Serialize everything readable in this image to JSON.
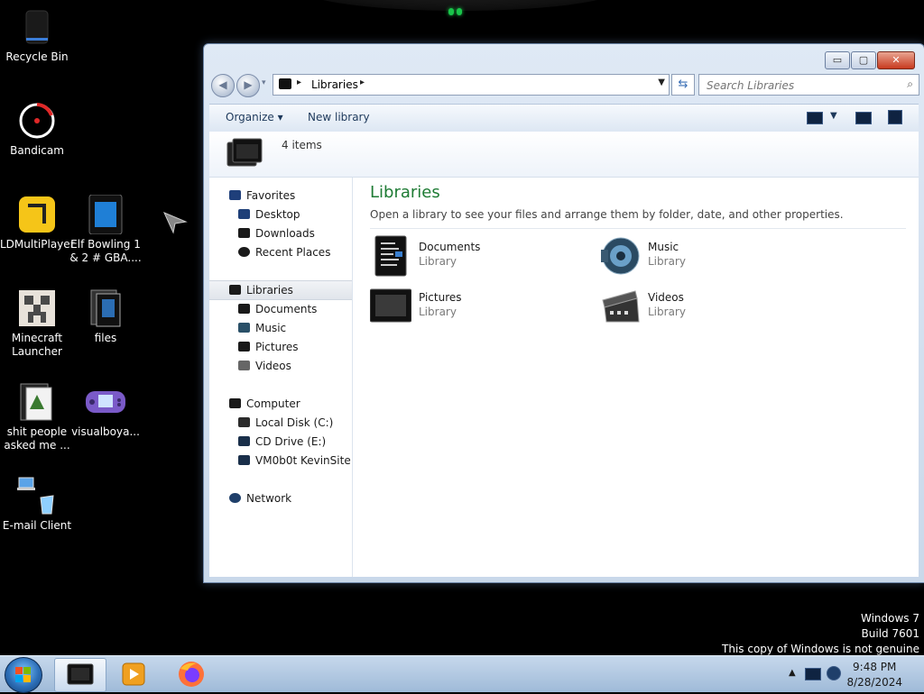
{
  "desktop": {
    "icons": [
      {
        "label": "Recycle Bin"
      },
      {
        "label": "Bandicam"
      },
      {
        "label": "LDMultiPlayer"
      },
      {
        "label": "Elf Bowling 1 & 2 # GBA...."
      },
      {
        "label": "Minecraft Launcher"
      },
      {
        "label": "files"
      },
      {
        "label": "shit people asked me ..."
      },
      {
        "label": "visualboya..."
      },
      {
        "label": "E-mail Client"
      }
    ]
  },
  "window": {
    "controls": {
      "minimize": "▭",
      "maximize": "▢",
      "close": "✕"
    },
    "address": {
      "path": "Libraries",
      "separator": "▸"
    },
    "search": {
      "placeholder": "Search Libraries"
    },
    "toolbar": {
      "organize": "Organize ▾",
      "new_library": "New library"
    },
    "info": {
      "count": "4 items"
    },
    "nav": {
      "favorites": "Favorites",
      "desktop": "Desktop",
      "downloads": "Downloads",
      "recent": "Recent Places",
      "libraries": "Libraries",
      "documents": "Documents",
      "music": "Music",
      "pictures": "Pictures",
      "videos": "Videos",
      "computer": "Computer",
      "local_disk": "Local Disk (C:)",
      "cd_drive": "CD Drive (E:)",
      "vm": "VM0b0t KevinSite",
      "network": "Network"
    },
    "main": {
      "title": "Libraries",
      "subtitle": "Open a library to see your files and arrange them by folder, date, and other properties.",
      "libraries": [
        {
          "name": "Documents",
          "type": "Library"
        },
        {
          "name": "Music",
          "type": "Library"
        },
        {
          "name": "Pictures",
          "type": "Library"
        },
        {
          "name": "Videos",
          "type": "Library"
        }
      ]
    }
  },
  "watermark": {
    "line1": "Windows 7",
    "line2": "Build 7601",
    "line3": "This copy of Windows is not genuine"
  },
  "taskbar": {
    "time": "9:48 PM",
    "date": "8/28/2024"
  },
  "colors": {
    "accent_green": "#1e7b34",
    "taskbar": "#b3cae4"
  }
}
